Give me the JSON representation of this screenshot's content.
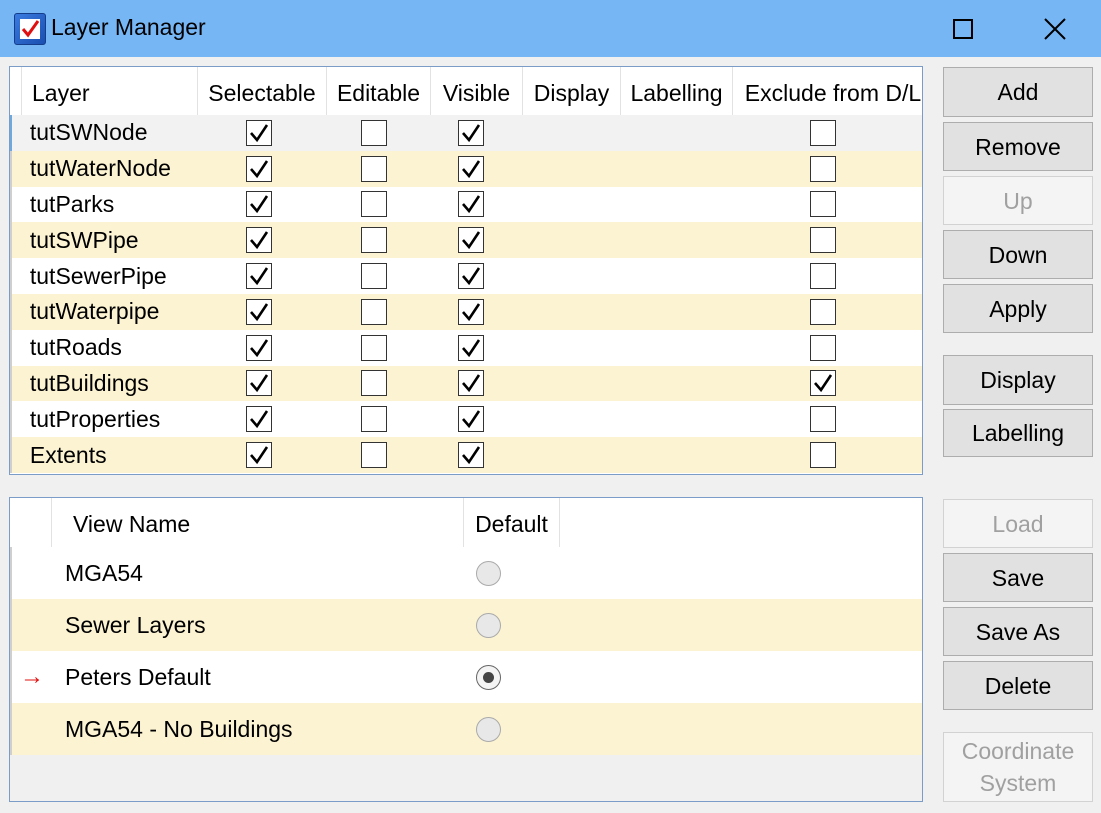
{
  "window": {
    "title": "Layer Manager"
  },
  "layers": {
    "columns": [
      "Layer",
      "Selectable",
      "Editable",
      "Visible",
      "Display",
      "Labelling",
      "Exclude from D/L"
    ],
    "rows": [
      {
        "name": "tutSWNode",
        "selectable": true,
        "editable": false,
        "visible": true,
        "exclude": false
      },
      {
        "name": "tutWaterNode",
        "selectable": true,
        "editable": false,
        "visible": true,
        "exclude": false
      },
      {
        "name": "tutParks",
        "selectable": true,
        "editable": false,
        "visible": true,
        "exclude": false
      },
      {
        "name": "tutSWPipe",
        "selectable": true,
        "editable": false,
        "visible": true,
        "exclude": false
      },
      {
        "name": "tutSewerPipe",
        "selectable": true,
        "editable": false,
        "visible": true,
        "exclude": false
      },
      {
        "name": "tutWaterpipe",
        "selectable": true,
        "editable": false,
        "visible": true,
        "exclude": false
      },
      {
        "name": "tutRoads",
        "selectable": true,
        "editable": false,
        "visible": true,
        "exclude": false
      },
      {
        "name": "tutBuildings",
        "selectable": true,
        "editable": false,
        "visible": true,
        "exclude": true
      },
      {
        "name": "tutProperties",
        "selectable": true,
        "editable": false,
        "visible": true,
        "exclude": false
      },
      {
        "name": "Extents",
        "selectable": true,
        "editable": false,
        "visible": true,
        "exclude": false
      }
    ]
  },
  "views": {
    "columns": [
      "View Name",
      "Default"
    ],
    "current_marker": "→",
    "rows": [
      {
        "name": "MGA54",
        "default": false,
        "current": false
      },
      {
        "name": "Sewer Layers",
        "default": false,
        "current": false
      },
      {
        "name": "Peters Default",
        "default": true,
        "current": true
      },
      {
        "name": "MGA54 - No Buildings",
        "default": false,
        "current": false
      }
    ]
  },
  "buttons": {
    "add": "Add",
    "remove": "Remove",
    "up": "Up",
    "down": "Down",
    "apply": "Apply",
    "display": "Display",
    "labelling": "Labelling",
    "load": "Load",
    "save": "Save",
    "save_as": "Save As",
    "delete": "Delete",
    "coordinate_system_line1": "Coordinate",
    "coordinate_system_line2": "System"
  },
  "colors": {
    "titlebar": "#77b6f5",
    "alt_row": "#fcf3d2",
    "marker": "#e01010"
  }
}
